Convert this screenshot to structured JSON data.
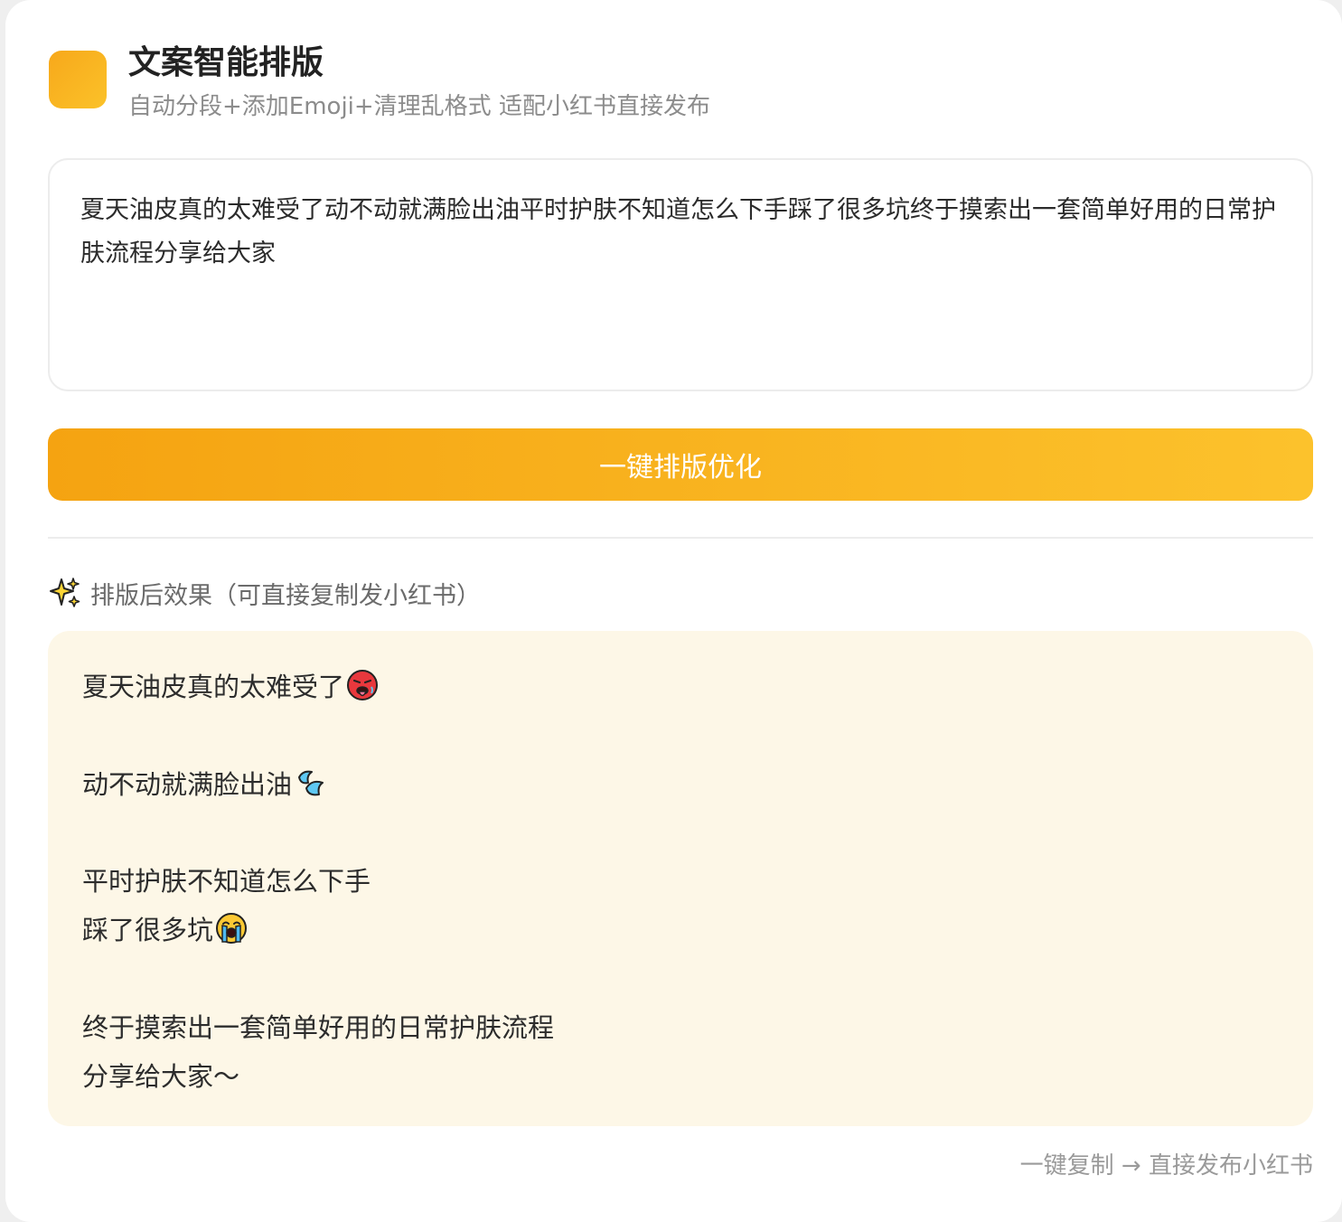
{
  "header": {
    "title": "文案智能排版",
    "subtitle": "自动分段+添加Emoji+清理乱格式 适配小红书直接发布",
    "logo_color": "#f9b520"
  },
  "input": {
    "value": "夏天油皮真的太难受了动不动就满脸出油平时护肤不知道怎么下手踩了很多坑终于摸索出一套简单好用的日常护肤流程分享给大家"
  },
  "format_button": {
    "label": "一键排版优化",
    "gradient_start": "#f5a311",
    "gradient_end": "#fcc22c"
  },
  "result": {
    "heading_icon": "sparkles-icon",
    "heading": "排版后效果（可直接复制发小红书）",
    "background": "#fdf7e7",
    "lines": [
      {
        "text": "夏天油皮真的太难受了",
        "emoji": "hot-face-icon"
      },
      {
        "text": "动不动就满脸出油",
        "emoji": "sweat-droplets-icon"
      },
      {
        "text": "平时护肤不知道怎么下手",
        "emoji": ""
      },
      {
        "text": "踩了很多坑",
        "emoji": "loudly-crying-face-icon"
      },
      {
        "text": "终于摸索出一套简单好用的日常护肤流程",
        "emoji": ""
      },
      {
        "text": "分享给大家～",
        "emoji": ""
      }
    ]
  },
  "footer": {
    "hint": "一键复制 → 直接发布小红书"
  }
}
